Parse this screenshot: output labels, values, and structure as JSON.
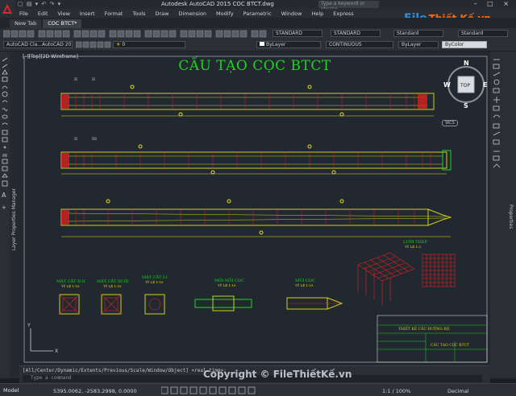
{
  "app": {
    "title": "Autodesk AutoCAD 2015    COC BTCT.dwg",
    "search_placeholder": "Type a keyword or phrase",
    "window_controls": "– □ ×"
  },
  "menu": [
    "File",
    "Edit",
    "View",
    "Insert",
    "Format",
    "Tools",
    "Draw",
    "Dimension",
    "Modify",
    "Parametric",
    "Window",
    "Help",
    "Express"
  ],
  "tabs": [
    {
      "label": "New Tab"
    },
    {
      "label": "COC BTCT*"
    }
  ],
  "toolbar": {
    "textstyle": "STANDARD",
    "dimstyle": "STANDARD",
    "tablestyle": "Standard",
    "mleaderstyle": "Standard",
    "workspace": "AutoCAD Cla...AutoCAD 2015",
    "layer": "0",
    "color": "ByLayer",
    "linetype": "CONTINUOUS",
    "lineweight": "ByLayer",
    "plotstyle": "ByColor"
  },
  "viewport": {
    "label": "[–][Top][2D Wireframe]",
    "wcs": "WCS"
  },
  "viewcube": {
    "n": "N",
    "s": "S",
    "e": "E",
    "w": "W",
    "top": "TOP"
  },
  "drawing": {
    "title": "CẤU TẠO CỌC BTCT",
    "sections": [
      {
        "name": "MẶT CẮT II-II",
        "scale": "TỶ LỆ 1:10"
      },
      {
        "name": "MẶT CẮT III-III",
        "scale": "TỶ LỆ 1:10"
      },
      {
        "name": "MẶT CẮT I-I",
        "scale": "TỶ LỆ 1:10"
      },
      {
        "name": "MỐI NỐI CỌC",
        "scale": "TỶ LỆ 1:10"
      },
      {
        "name": "MŨI CỌC",
        "scale": "TỶ LỆ 1:10"
      },
      {
        "name": "LƯỚI THÉP",
        "scale": "TỶ LỆ 1:3"
      }
    ],
    "titleblock": {
      "project": "THIẾT KẾ CẦU ĐƯỜNG BỘ",
      "sheet": "CẤU TẠO CỌC BTCT"
    }
  },
  "command": {
    "history": "[All/Center/Dynamic/Extents/Previous/Scale/Window/Object] <real time>:",
    "placeholder": "Type a command"
  },
  "status": {
    "model": "Model",
    "coords": "5395.0062, -2583.2998, 0.0000",
    "scale": "1:1 / 100%",
    "units": "Decimal"
  },
  "watermark": {
    "text": "Copyright © FileThiếtKế.vn",
    "brand_a": "File",
    "brand_b": "Thiết Kế.vn"
  },
  "colors": {
    "piles": "#d0d018",
    "dim": "#e8e010",
    "rebar": "#e02020",
    "accent": "#20d320",
    "bg": "#212830"
  }
}
